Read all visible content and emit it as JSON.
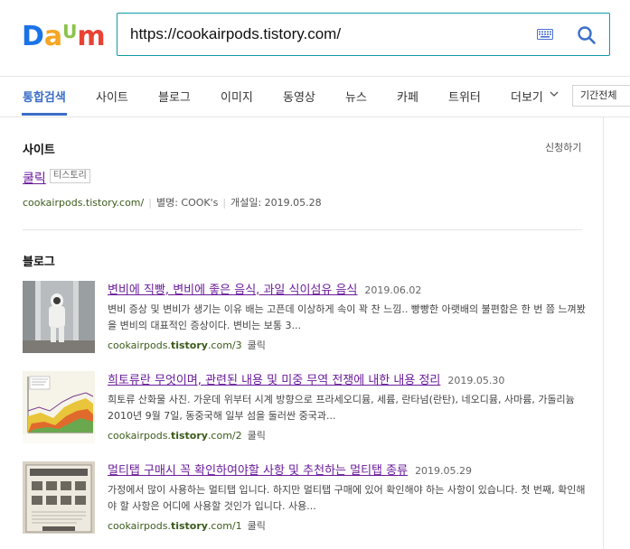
{
  "logo": {
    "letters": [
      "D",
      "a",
      "U",
      "m"
    ],
    "colors": [
      "#1a73e8",
      "#f5a623",
      "#8bc34a",
      "#e94235"
    ]
  },
  "search": {
    "value": "https://cookairpods.tistory.com/",
    "placeholder": "",
    "border_color": "#0e9aa5"
  },
  "tabs": [
    {
      "label": "통합검색",
      "active": true
    },
    {
      "label": "사이트"
    },
    {
      "label": "블로그"
    },
    {
      "label": "이미지"
    },
    {
      "label": "동영상"
    },
    {
      "label": "뉴스"
    },
    {
      "label": "카페"
    },
    {
      "label": "트위터"
    },
    {
      "label": "더보기"
    }
  ],
  "period_filter": "기간전체",
  "site_section": {
    "title": "사이트",
    "apply_link": "신청하기",
    "site_name": "쿨릭",
    "badge": "티스토리",
    "url": "cookairpods.tistory.com/",
    "alias": "별명: COOK's",
    "opened": "개설일: 2019.05.28"
  },
  "blog_section": {
    "title": "블로그",
    "items": [
      {
        "title": "변비에 직빵, 변비에 좋은 음식, 과일 식이섬유 음식",
        "date": "2019.06.02",
        "desc": "변비 증상 및 변비가 생기는 이유 배는 고픈데 이상하게 속이 꽉 찬 느낌.. 빵빵한 아랫배의 불편함은 한 번 쯤 느껴봤을 변비의 대표적인 증상이다. 변비는 보통 3...",
        "url_prefix": "cookairpods.",
        "url_bold": "tistory",
        "url_suffix": ".com/3",
        "blog_name": "쿨릭"
      },
      {
        "title": "희토류란 무엇이며, 관련된 내용 및 미중 무역 전쟁에 내한 내용 정리",
        "date": "2019.05.30",
        "desc": "희토류 산화물 사진. 가운데 위부터 시계 방향으로 프라세오디뮴, 세륨, 란타넘(란탄), 네오디뮴, 사마륨, 가돌리늄 2010년 9월 7일, 동중국해 일부 섬을 둘러싼 중국과...",
        "url_prefix": "cookairpods.",
        "url_bold": "tistory",
        "url_suffix": ".com/2",
        "blog_name": "쿨릭"
      },
      {
        "title": "멀티탭 구매시 꼭 확인하여야할 사항 및 추천하는 멀티탭 종류",
        "date": "2019.05.29",
        "desc": "가정에서 많이 사용하는 멀티탭 입니다. 하지만 멀티탭 구매에 있어 확인해야 하는 사항이 있습니다. 첫 번째, 확인해야 할 사항은 어디에 사용할 것인가 입니다. 사용...",
        "url_prefix": "cookairpods.",
        "url_bold": "tistory",
        "url_suffix": ".com/1",
        "blog_name": "쿨릭"
      }
    ]
  }
}
